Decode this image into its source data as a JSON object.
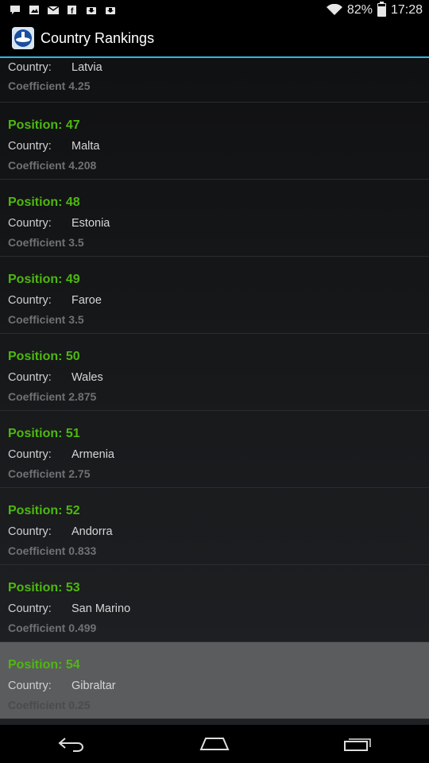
{
  "status_bar": {
    "battery_percent": "82%",
    "battery_level": 0.82,
    "time": "17:28",
    "icons": [
      "notification-icon",
      "image-icon",
      "gmail-icon",
      "facebook-icon",
      "download-icon",
      "download-icon"
    ]
  },
  "app": {
    "title": "Country Rankings",
    "accent_color": "#33b5e5",
    "position_color": "#4eb80f"
  },
  "list": {
    "country_label": "Country:",
    "partial_top": {
      "country": "Latvia",
      "coefficient": "Coefficient 4.25"
    },
    "rows": [
      {
        "position": "Position: 47",
        "country": "Malta",
        "coefficient": "Coefficient 4.208"
      },
      {
        "position": "Position: 48",
        "country": "Estonia",
        "coefficient": "Coefficient 3.5"
      },
      {
        "position": "Position: 49",
        "country": "Faroe",
        "coefficient": "Coefficient 3.5"
      },
      {
        "position": "Position: 50",
        "country": "Wales",
        "coefficient": "Coefficient 2.875"
      },
      {
        "position": "Position: 51",
        "country": "Armenia",
        "coefficient": "Coefficient 2.75"
      },
      {
        "position": "Position: 52",
        "country": "Andorra",
        "coefficient": "Coefficient 0.833"
      },
      {
        "position": "Position: 53",
        "country": "San Marino",
        "coefficient": "Coefficient 0.499"
      },
      {
        "position": "Position: 54",
        "country": "Gibraltar",
        "coefficient": "Coefficient 0.25"
      }
    ]
  },
  "nav": {
    "icons": [
      "back-icon",
      "home-icon",
      "recents-icon"
    ]
  }
}
